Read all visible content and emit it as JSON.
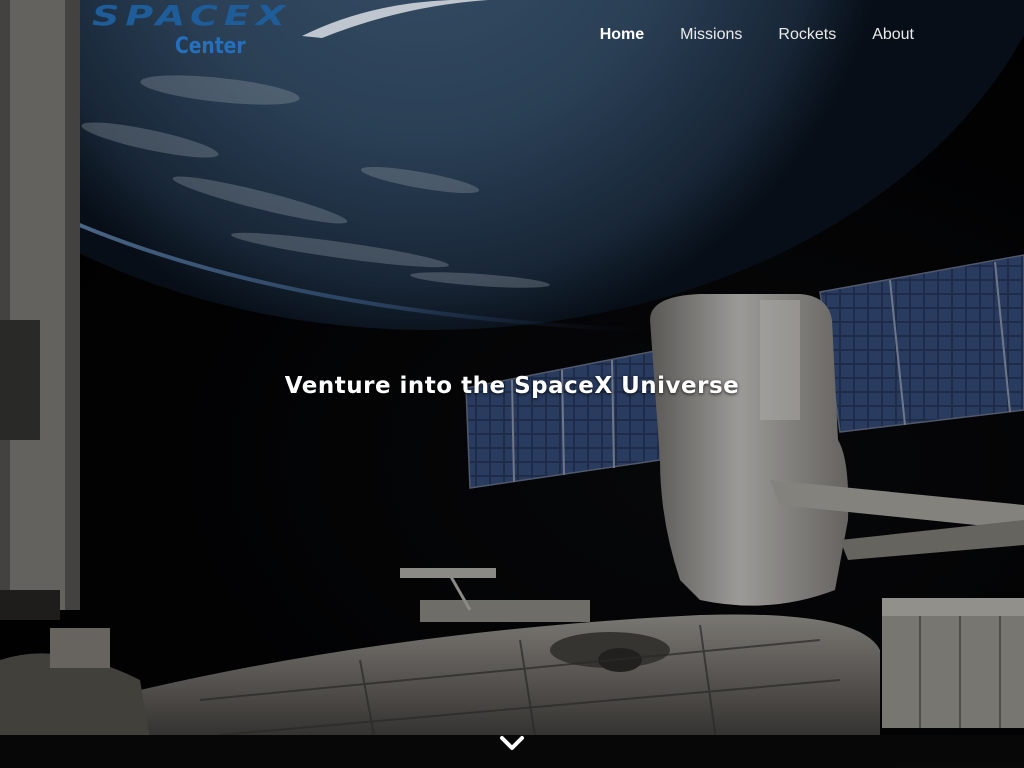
{
  "brand": {
    "logo_word": "SPACEX",
    "logo_sub": "Center",
    "logo_color": "#1e5d99",
    "logo_sub_color": "#2470bd"
  },
  "nav": {
    "items": [
      {
        "label": "Home",
        "active": true
      },
      {
        "label": "Missions",
        "active": false
      },
      {
        "label": "Rockets",
        "active": false
      },
      {
        "label": "About",
        "active": false
      }
    ]
  },
  "hero": {
    "title": "Venture into the SpaceX Universe",
    "scroll_icon": "chevron-down-icon"
  }
}
